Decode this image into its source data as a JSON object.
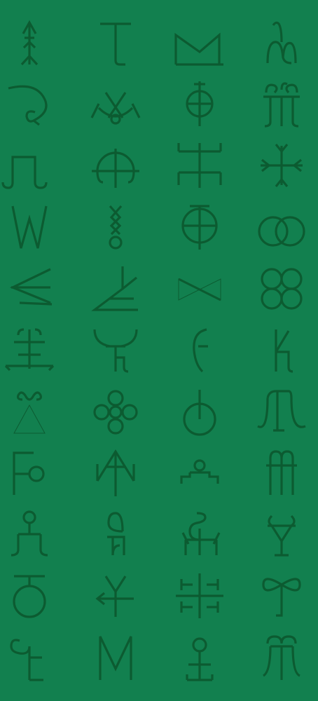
{
  "background_color": "#12804f",
  "glyph_color": "#0c5b31",
  "pattern": {
    "columns": 4,
    "rows": 11,
    "symbols": [
      "arrow-pole",
      "t-hook",
      "bowl-m",
      "hook-loop",
      "curl-hook",
      "crescent-fork",
      "circle-cross",
      "triple-curl",
      "square-wave",
      "arch-cross",
      "double-bar-cross",
      "four-point-cross",
      "w-mark",
      "diamond-knot",
      "barred-circle",
      "double-ring",
      "three-prong",
      "angle-branch",
      "bowtie",
      "four-leaf",
      "crowned-bar",
      "curled-fork",
      "bent-hook",
      "step-hook",
      "spiral-triangle",
      "quatrefoil",
      "balloon-circle",
      "curled-arch",
      "flag-ring",
      "open-arrow",
      "dome-step",
      "curled-pillars",
      "figure-loop",
      "loop-9",
      "loop-trident",
      "y-loop",
      "bar-circle",
      "fork-arrow",
      "branch-star",
      "ribbon-hook",
      "s-hook",
      "big-m",
      "circle-stand",
      "double-spiral"
    ]
  }
}
